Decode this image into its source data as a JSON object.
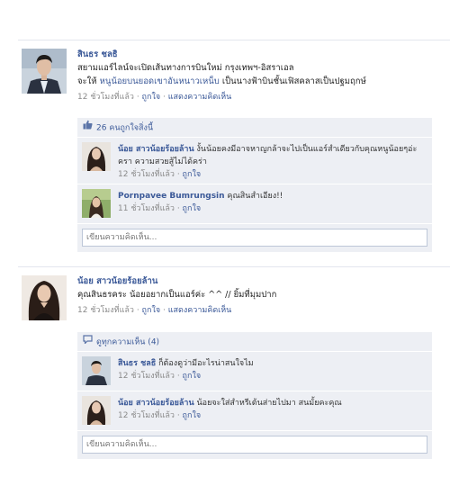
{
  "post1": {
    "author": "สินธร ชลธิ",
    "line1": "สยามแอร์ไลน์จะเปิดเส้นทางการบินใหม่ กรุงเทพฯ-อิสราเอล",
    "line2_prefix": "จะให้ ",
    "line2_link": "หนูน้อยบนยอดเขาอันหนาวเหน็บ",
    "line2_suffix": " เป็นนางฟ้าบินชั้นเฟิสคลาสเป็นปฐมฤกษ์",
    "time": "12 ชั่วโมงที่แล้ว",
    "like_link": "ถูกใจ",
    "comment_link": "แสดงความคิดเห็น",
    "likes_text": "26 คนถูกใจสิ่งนี้",
    "comments": [
      {
        "author": "น้อย สาวน้อยร้อยล้าน",
        "text": "งั้นน้อยคงมีอาจหาญกล้าจะไปเป็นแอร์สำเดียวกับคุณหนูน้อยๆอ่ะครา ความสวยสู้ไม่ได้คร่า",
        "time": "12 ชั่วโมงที่แล้ว",
        "like": "ถูกใจ"
      },
      {
        "author": "Pornpavee Bumrungsin",
        "text": "คุณสินสำเอียง!!",
        "time": "11 ชั่วโมงที่แล้ว",
        "like": "ถูกใจ"
      }
    ],
    "input_placeholder": "เขียนความคิดเห็น..."
  },
  "post2": {
    "author": "น้อย สาวน้อยร้อยล้าน",
    "line1": "คุณสินธรคระ น้อยอยากเป็นแอร์ค่ะ ^^ // ยิ้มที่มุมปาก",
    "time": "12 ชั่วโมงที่แล้ว",
    "like_link": "ถูกใจ",
    "comment_link": "แสดงความคิดเห็น",
    "view_all": "ดูทุกความเห็น (4)",
    "comments": [
      {
        "author": "สินธร ชลธิ",
        "text": "ก็ต้องดูว่ามีอะไรน่าสนใจไม",
        "time": "12 ชั่วโมงที่แล้ว",
        "like": "ถูกใจ"
      },
      {
        "author": "น้อย สาวน้อยร้อยล้าน",
        "text": "น้อยจะใส่สำหรีเต้นส่ายไปมา สนมั้ยคะคุณ",
        "time": "12 ชั่วโมงที่แล้ว",
        "like": "ถูกใจ"
      }
    ],
    "input_placeholder": "เขียนความคิดเห็น..."
  },
  "separator": " · ",
  "colors": {
    "link": "#3b5998",
    "ufi_bg": "#edeff4",
    "meta": "#8a8a8a"
  }
}
